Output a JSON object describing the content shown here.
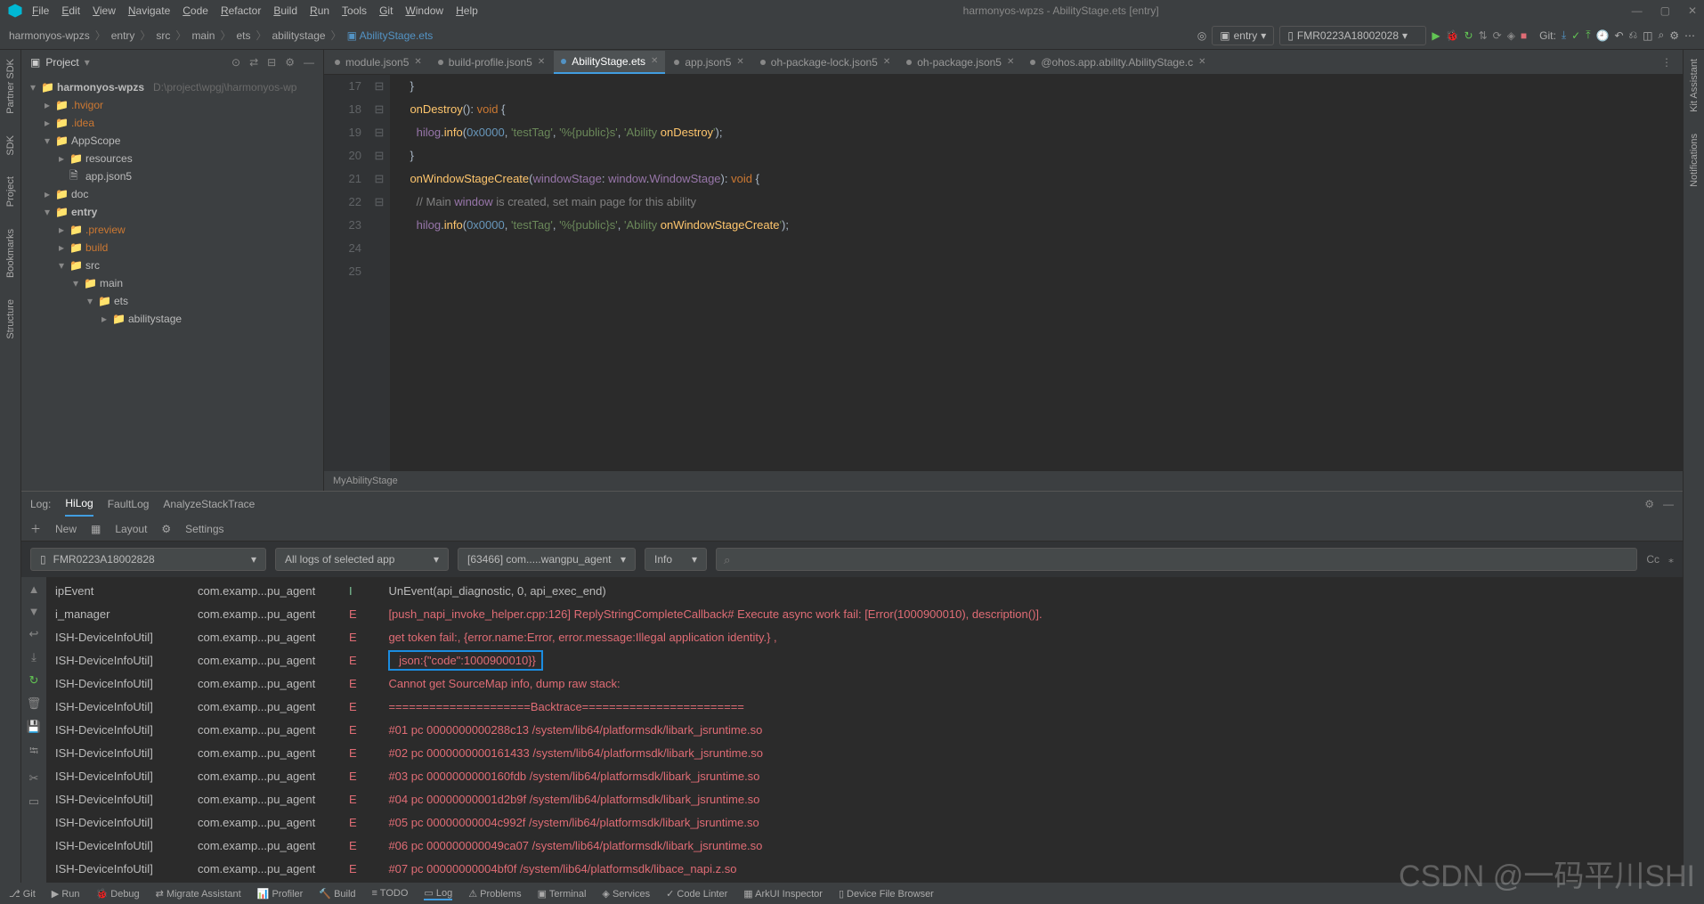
{
  "window": {
    "title": "harmonyos-wpzs - AbilityStage.ets [entry]"
  },
  "menu": [
    "File",
    "Edit",
    "View",
    "Navigate",
    "Code",
    "Refactor",
    "Build",
    "Run",
    "Tools",
    "Git",
    "Window",
    "Help"
  ],
  "breadcrumb": [
    "harmonyos-wpzs",
    "entry",
    "src",
    "main",
    "ets",
    "abilitystage",
    "AbilityStage.ets"
  ],
  "run_config": "entry",
  "device": "FMR0223A18002028",
  "git_label": "Git:",
  "project_label": "Project",
  "left_rail": [
    "Partner SDK",
    "SDK",
    "Project",
    "Bookmarks",
    "Structure"
  ],
  "right_rail": [
    "Kit Assistant",
    "Notifications"
  ],
  "tree": [
    {
      "indent": 0,
      "chev": "▾",
      "label": "harmonyos-wpzs",
      "suffix": "D:\\project\\wpgj\\harmonyos-wp",
      "bold": true,
      "folder": true
    },
    {
      "indent": 1,
      "chev": "▸",
      "label": ".hvigor",
      "folder": true,
      "orange": true
    },
    {
      "indent": 1,
      "chev": "▸",
      "label": ".idea",
      "folder": true,
      "orange": true
    },
    {
      "indent": 1,
      "chev": "▾",
      "label": "AppScope",
      "folder": true
    },
    {
      "indent": 2,
      "chev": "▸",
      "label": "resources",
      "folder": true
    },
    {
      "indent": 2,
      "chev": "",
      "label": "app.json5",
      "folder": false
    },
    {
      "indent": 1,
      "chev": "▸",
      "label": "doc",
      "folder": true
    },
    {
      "indent": 1,
      "chev": "▾",
      "label": "entry",
      "folder": true,
      "bold": true
    },
    {
      "indent": 2,
      "chev": "▸",
      "label": ".preview",
      "folder": true,
      "orange": true
    },
    {
      "indent": 2,
      "chev": "▸",
      "label": "build",
      "folder": true,
      "orange": true
    },
    {
      "indent": 2,
      "chev": "▾",
      "label": "src",
      "folder": true
    },
    {
      "indent": 3,
      "chev": "▾",
      "label": "main",
      "folder": true
    },
    {
      "indent": 4,
      "chev": "▾",
      "label": "ets",
      "folder": true
    },
    {
      "indent": 5,
      "chev": "▸",
      "label": "abilitystage",
      "folder": true
    }
  ],
  "tabs": [
    {
      "label": "module.json5",
      "active": false
    },
    {
      "label": "build-profile.json5",
      "active": false
    },
    {
      "label": "AbilityStage.ets",
      "active": true
    },
    {
      "label": "app.json5",
      "active": false
    },
    {
      "label": "oh-package-lock.json5",
      "active": false
    },
    {
      "label": "oh-package.json5",
      "active": false
    },
    {
      "label": "@ohos.app.ability.AbilityStage.c",
      "active": false
    }
  ],
  "code": {
    "lines": [
      {
        "n": 17,
        "t": "    }"
      },
      {
        "n": 18,
        "t": ""
      },
      {
        "n": 19,
        "t": "    onDestroy(): void {"
      },
      {
        "n": 20,
        "t": "      hilog.info(0x0000, 'testTag', '%{public}s', 'Ability onDestroy');"
      },
      {
        "n": 21,
        "t": "    }"
      },
      {
        "n": 22,
        "t": ""
      },
      {
        "n": 23,
        "t": "    onWindowStageCreate(windowStage: window.WindowStage): void {"
      },
      {
        "n": 24,
        "t": "      // Main window is created, set main page for this ability"
      },
      {
        "n": 25,
        "t": "      hilog.info(0x0000, 'testTag', '%{public}s', 'Ability onWindowStageCreate');"
      }
    ],
    "class_hint": "MyAbilityStage"
  },
  "log": {
    "header": "Log:",
    "tabs": [
      "HiLog",
      "FaultLog",
      "AnalyzeStackTrace"
    ],
    "toolbar": [
      "New",
      "Layout",
      "Settings"
    ],
    "device": "FMR0223A18002828",
    "filter_app": "All logs of selected app",
    "filter_proc": "[63466] com.....wangpu_agent",
    "filter_level": "Info",
    "search_placeholder": "⌕",
    "cc_label": "Cc",
    "rows": [
      {
        "tag": "ipEvent",
        "pkg": "com.examp...pu_agent",
        "lvl": "I",
        "msg": "UnEvent(api_diagnostic, 0, api_exec_end)",
        "info": true
      },
      {
        "tag": "i_manager",
        "pkg": "com.examp...pu_agent",
        "lvl": "E",
        "msg": "[push_napi_invoke_helper.cpp:126] ReplyStringCompleteCallback# Execute async work fail: [Error(1000900010), description()]."
      },
      {
        "tag": "ISH-DeviceInfoUtil]",
        "pkg": "com.examp...pu_agent",
        "lvl": "E",
        "msg": "get token fail:, {error.name:Error, error.message:Illegal application identity.} ,"
      },
      {
        "tag": "ISH-DeviceInfoUtil]",
        "pkg": "com.examp...pu_agent",
        "lvl": "E",
        "msg": " json:{\"code\":1000900010}}",
        "highlight": true
      },
      {
        "tag": "ISH-DeviceInfoUtil]",
        "pkg": "com.examp...pu_agent",
        "lvl": "E",
        "msg": "Cannot get SourceMap info, dump raw stack:"
      },
      {
        "tag": "ISH-DeviceInfoUtil]",
        "pkg": "com.examp...pu_agent",
        "lvl": "E",
        "msg": "=====================Backtrace========================"
      },
      {
        "tag": "ISH-DeviceInfoUtil]",
        "pkg": "com.examp...pu_agent",
        "lvl": "E",
        "msg": "#01 pc 0000000000288c13 /system/lib64/platformsdk/libark_jsruntime.so"
      },
      {
        "tag": "ISH-DeviceInfoUtil]",
        "pkg": "com.examp...pu_agent",
        "lvl": "E",
        "msg": "#02 pc 0000000000161433 /system/lib64/platformsdk/libark_jsruntime.so"
      },
      {
        "tag": "ISH-DeviceInfoUtil]",
        "pkg": "com.examp...pu_agent",
        "lvl": "E",
        "msg": "#03 pc 0000000000160fdb /system/lib64/platformsdk/libark_jsruntime.so"
      },
      {
        "tag": "ISH-DeviceInfoUtil]",
        "pkg": "com.examp...pu_agent",
        "lvl": "E",
        "msg": "#04 pc 00000000001d2b9f /system/lib64/platformsdk/libark_jsruntime.so"
      },
      {
        "tag": "ISH-DeviceInfoUtil]",
        "pkg": "com.examp...pu_agent",
        "lvl": "E",
        "msg": "#05 pc 00000000004c992f /system/lib64/platformsdk/libark_jsruntime.so"
      },
      {
        "tag": "ISH-DeviceInfoUtil]",
        "pkg": "com.examp...pu_agent",
        "lvl": "E",
        "msg": "#06 pc 000000000049ca07 /system/lib64/platformsdk/libark_jsruntime.so"
      },
      {
        "tag": "ISH-DeviceInfoUtil]",
        "pkg": "com.examp...pu_agent",
        "lvl": "E",
        "msg": "#07 pc 00000000004bf0f /system/lib64/platformsdk/libace_napi.z.so"
      }
    ]
  },
  "statusbar": [
    "Git",
    "Run",
    "Debug",
    "Migrate Assistant",
    "Profiler",
    "Build",
    "TODO",
    "Log",
    "Problems",
    "Terminal",
    "Services",
    "Code Linter",
    "ArkUI Inspector",
    "Device File Browser"
  ],
  "statusbar_active": "Log",
  "watermark": "CSDN @一码平川SHI"
}
